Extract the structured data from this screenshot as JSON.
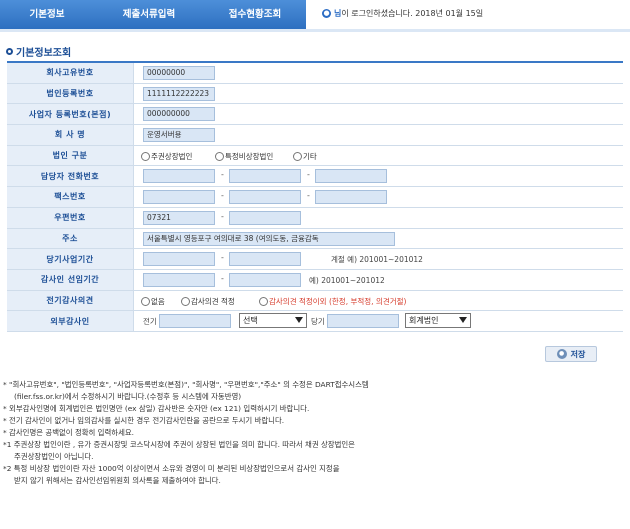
{
  "tabs": [
    "기본정보",
    "제출서류입력",
    "접수현황조회"
  ],
  "login": {
    "name": "님",
    "message": "이 로그인하셨습니다. 2018년 01월 15일"
  },
  "section_title": "기본정보조회",
  "form": {
    "company_code": {
      "label": "회사고유번호",
      "value": "00000000"
    },
    "corp_reg_no": {
      "label": "법인등록번호",
      "value": "1111112222223"
    },
    "biz_reg_no": {
      "label": "사업자 등록번호(본점)",
      "value": "000000000"
    },
    "company_name": {
      "label": "회 사 명",
      "value": "운영서버용"
    },
    "corp_type": {
      "label": "법인 구분",
      "options": [
        "주권상장법인",
        "특정비상장법인",
        "기타"
      ]
    },
    "phone": {
      "label": "담당자 전화번호"
    },
    "fax": {
      "label": "팩스번호"
    },
    "postal": {
      "label": "우편번호",
      "value": "07321"
    },
    "address": {
      "label": "주소",
      "value": "서울특별시 영등포구 여의대로 38 (여의도동, 금융감독"
    },
    "fiscal_period": {
      "label": "당기사업기간",
      "hint": "계절   예) 201001~201012"
    },
    "auditor_period": {
      "label": "감사인 선임기간",
      "hint": "예) 201001~201012"
    },
    "audit_opinion": {
      "label": "전기감사의견",
      "options": [
        "없음",
        "감사의견 적정",
        "감사의견 적정이외 (한정, 부적정, 의견거절)"
      ]
    },
    "external_auditor": {
      "label": "외부감사인",
      "prev_label": "전기",
      "curr_label": "당기",
      "select1": "선택",
      "select2": "회계법인"
    }
  },
  "save_label": "저장",
  "notes": [
    "* \"회사고유번호\", \"법인등록번호\", \"사업자등록번호(본점)\", \"회사명\", \"우편번호\",\"주소\" 의 수정은 DART접수시스템",
    "(filer.fss.or.kr)에서 수정하시기 바랍니다.(수정후 등 시스템에 자동반영)",
    "* 외부감사인명에 회계법인은 법인명만 (ex 삼일) 감사반은 숫자만 (ex 121) 입력하시기 바랍니다.",
    "* 전기 감사인이 없거나 임의감사를 실시한 경우 전기감사인란을 공란으로 두시기 바랍니다.",
    "* 감사인명은 공백없이 정확히 입력하세요.",
    "*1 주권상장 법인이란 , 유가 증권시장및 코스닥시장에 주권이 상장된 법인을 의미 합니다. 따라서 채권 상장법인은",
    "주권상장법인이 아닙니다.",
    "*2 특정 비상장 법인이란 자산 1000억 이상이면서 소유와 경영이 미 분리된 비상장법인으로서 감사인 지정을",
    "받지 않기 위해서는 감사인선임위원회 의사록을 제출하여야 합니다."
  ]
}
